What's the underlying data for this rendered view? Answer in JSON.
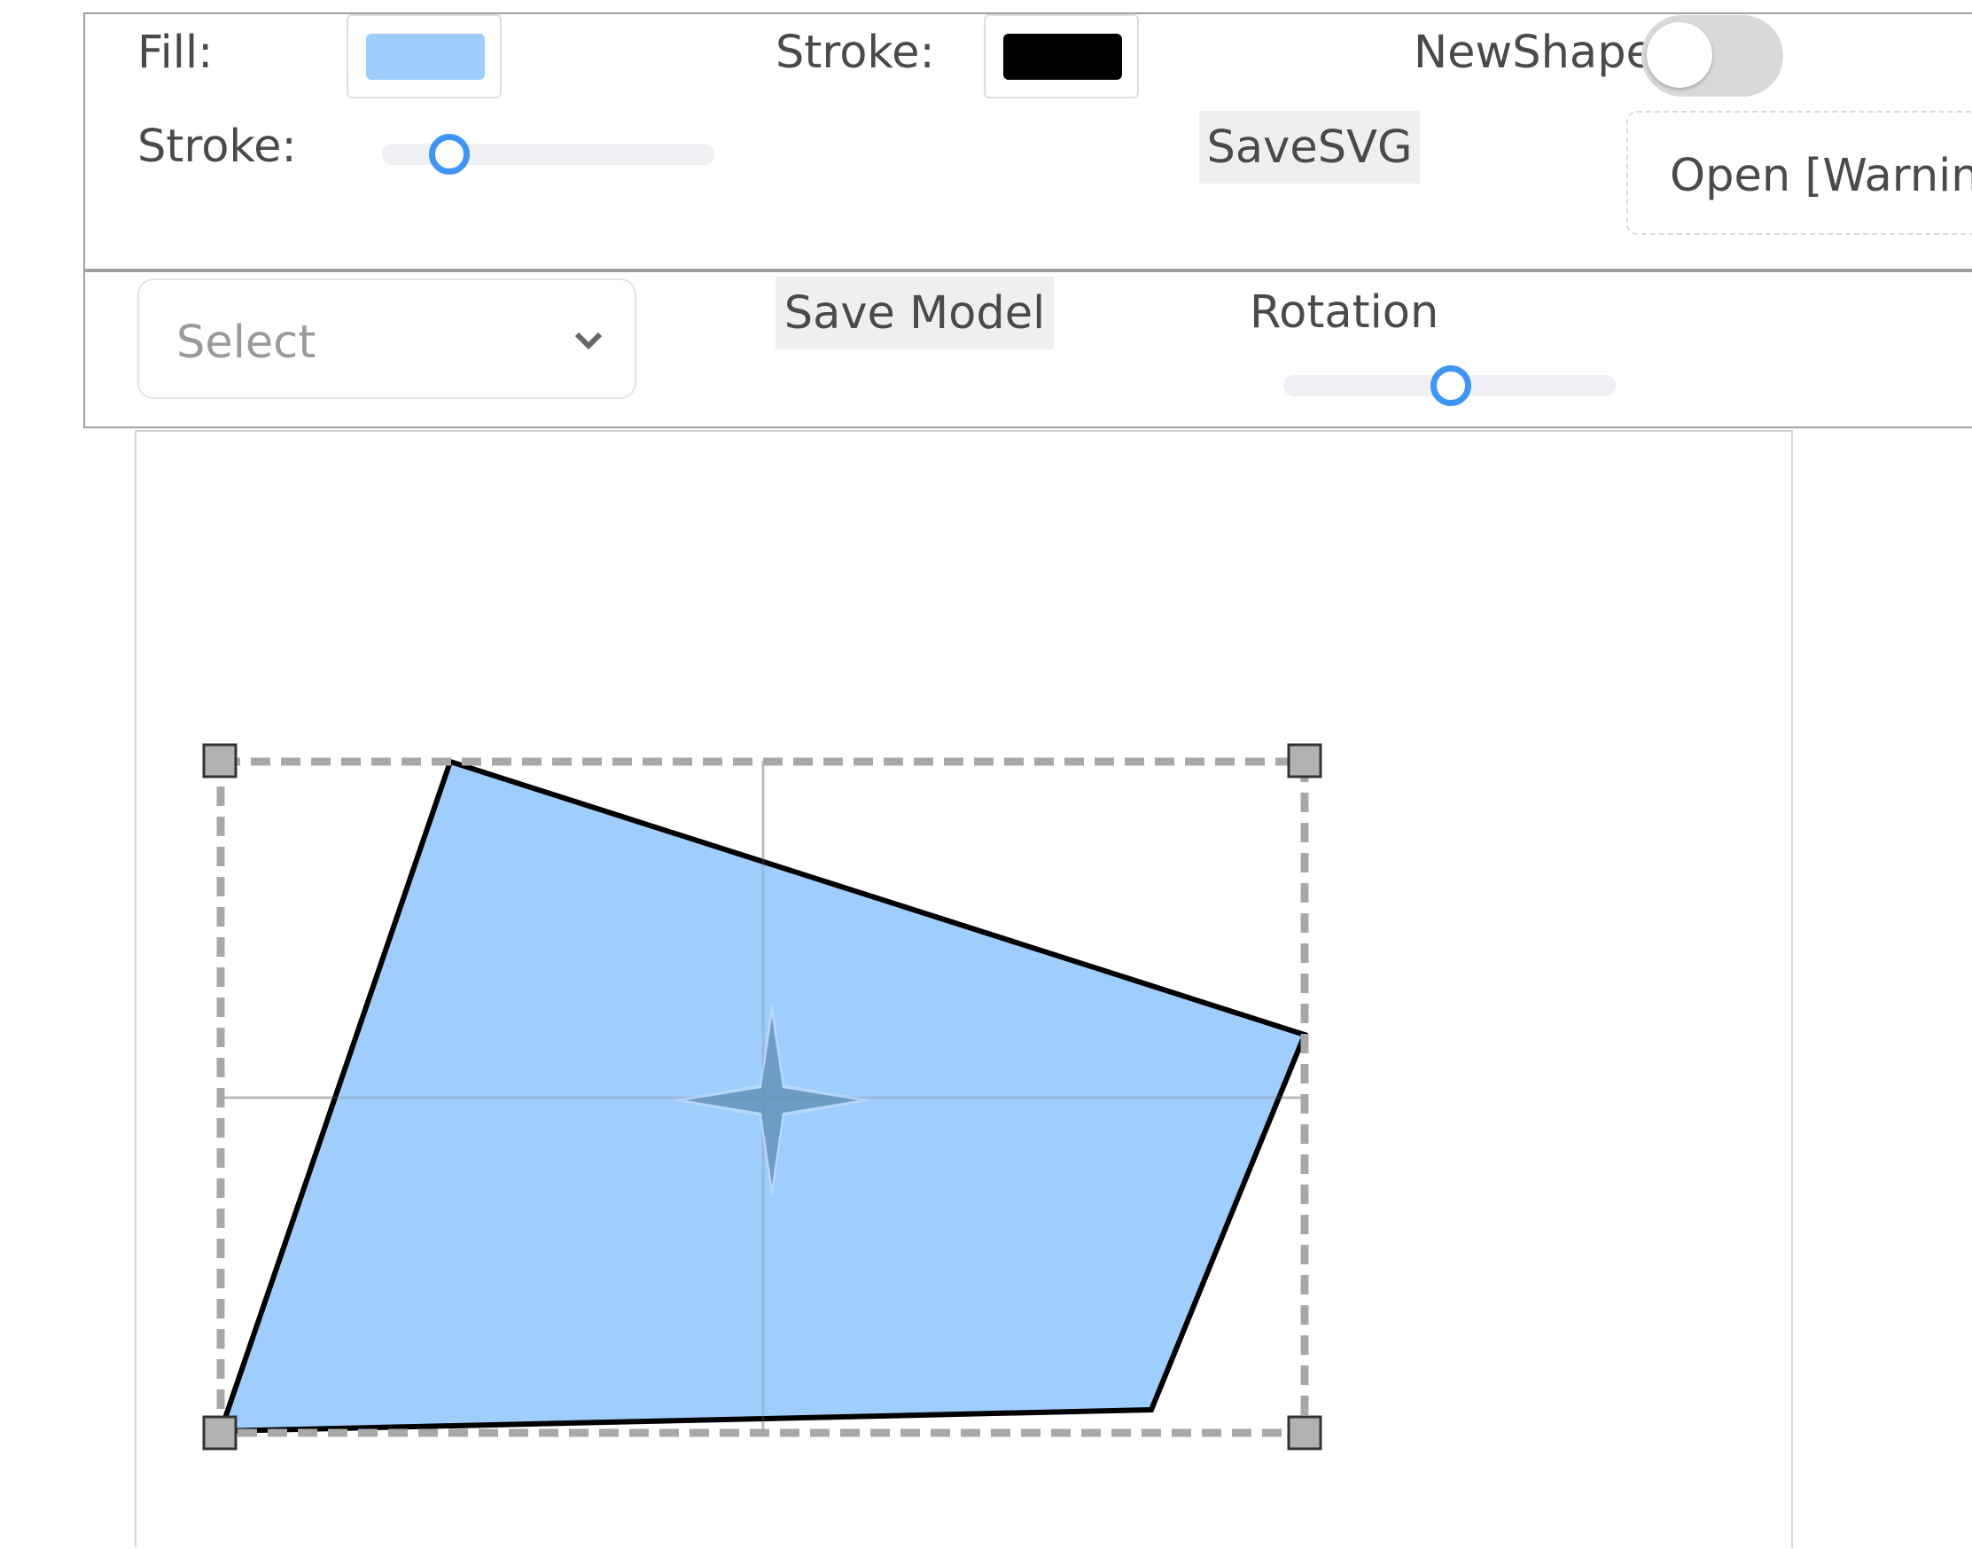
{
  "toolbar": {
    "fill_label": "Fill:",
    "fill_color": "#9ecdfc",
    "stroke_color_label": "Stroke:",
    "stroke_color": "#000000",
    "newshape_label": "NewShape:",
    "newshape_on": false,
    "stroke_width_label": "Stroke:",
    "stroke_width_level": 0.2,
    "save_svg_label": "SaveSVG",
    "open_label": "Open [Warning"
  },
  "model_bar": {
    "select_placeholder": "Select",
    "save_model_label": "Save Model",
    "rotation_label": "Rotation",
    "rotation_level": 0.5
  },
  "canvas": {
    "shape_fill": "#9ecdfc",
    "shape_stroke": "#000000",
    "selection_color": "#a8a8a8",
    "accent_color": "#3f95f2"
  },
  "icons": {
    "select_chevron": "chevron-down-icon",
    "center_handle": "four-point-star-icon",
    "corner_handles": "square-handle-icon"
  }
}
